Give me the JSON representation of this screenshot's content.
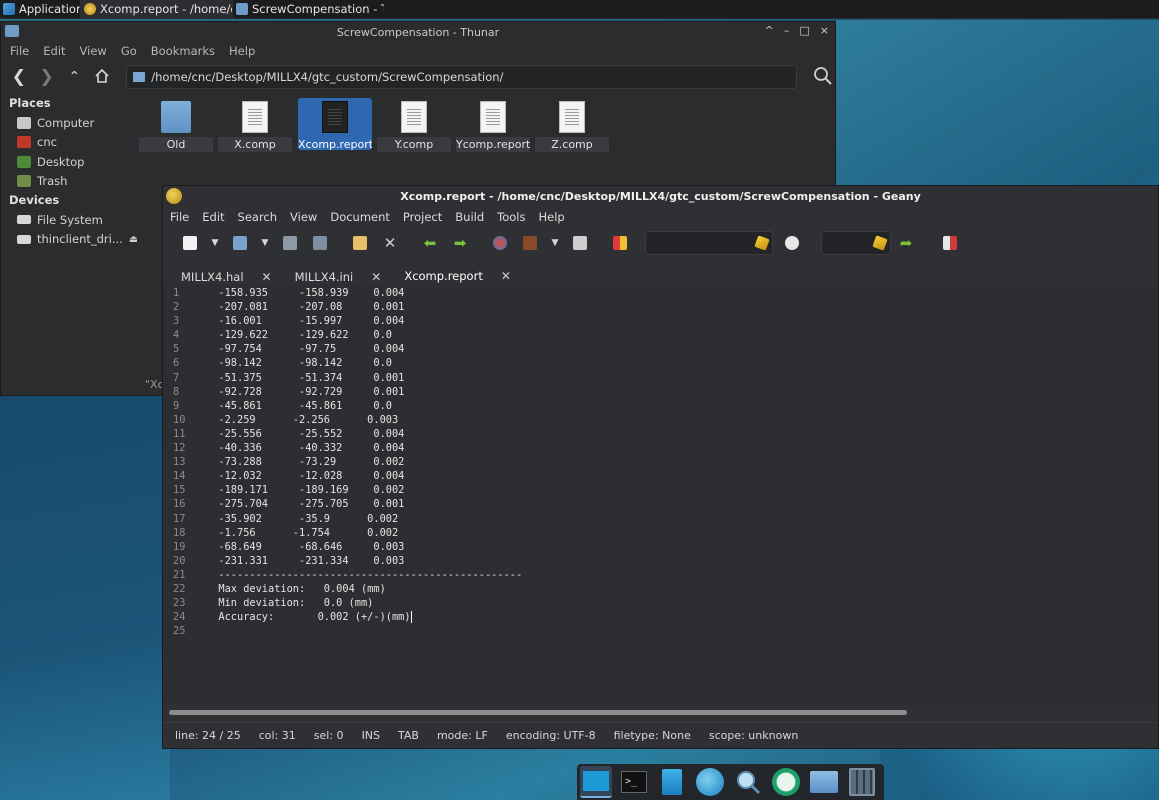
{
  "taskbar": {
    "apps_label": "Applications",
    "tasks": [
      {
        "label": "Xcomp.report - /home/c..."
      },
      {
        "label": "ScrewCompensation - T..."
      }
    ]
  },
  "thunar": {
    "title": "ScrewCompensation - Thunar",
    "controls": {
      "minimize": "^",
      "maximize": "–",
      "restore": "□",
      "close": "×"
    },
    "menu": [
      "File",
      "Edit",
      "View",
      "Go",
      "Bookmarks",
      "Help"
    ],
    "path": "/home/cnc/Desktop/MILLX4/gtc_custom/ScrewCompensation/",
    "places_header": "Places",
    "places": [
      "Computer",
      "cnc",
      "Desktop",
      "Trash"
    ],
    "devices_header": "Devices",
    "devices": [
      "File System",
      "thinclient_dri..."
    ],
    "files": [
      "Old",
      "X.comp",
      "Xcomp.report",
      "Y.comp",
      "Ycomp.report",
      "Z.comp"
    ],
    "selected_file": "Xcomp.report",
    "status_partial": "\"Xc"
  },
  "geany": {
    "title": "Xcomp.report - /home/cnc/Desktop/MILLX4/gtc_custom/ScrewCompensation - Geany",
    "menu": [
      "File",
      "Edit",
      "Search",
      "View",
      "Document",
      "Project",
      "Build",
      "Tools",
      "Help"
    ],
    "tabs": [
      {
        "label": "MILLX4.hal"
      },
      {
        "label": "MILLX4.ini"
      },
      {
        "label": "Xcomp.report"
      }
    ],
    "active_tab": "Xcomp.report",
    "search_placeholder": "",
    "goto_placeholder": "",
    "lines": [
      "-158.935     -158.939    0.004",
      "-207.081     -207.08     0.001",
      "-16.001      -15.997     0.004",
      "-129.622     -129.622    0.0",
      "-97.754      -97.75      0.004",
      "-98.142      -98.142     0.0",
      "-51.375      -51.374     0.001",
      "-92.728      -92.729     0.001",
      "-45.861      -45.861     0.0",
      "-2.259      -2.256      0.003",
      "-25.556      -25.552     0.004",
      "-40.336      -40.332     0.004",
      "-73.288      -73.29      0.002",
      "-12.032      -12.028     0.004",
      "-189.171     -189.169    0.002",
      "-275.704     -275.705    0.001",
      "-35.902      -35.9      0.002",
      "-1.756      -1.754      0.002",
      "-68.649      -68.646     0.003",
      "-231.331     -231.334    0.003",
      "-------------------------------------------------",
      "Max deviation:   0.004 (mm)",
      "Min deviation:   0.0 (mm)",
      "Accuracy:       0.002 (+/-)(mm)",
      ""
    ],
    "status": {
      "line": "line: 24 / 25",
      "col": "col: 31",
      "sel": "sel: 0",
      "ins": "INS",
      "tab": "TAB",
      "mode": "mode: LF",
      "encoding": "encoding: UTF-8",
      "filetype": "filetype: None",
      "scope": "scope: unknown"
    }
  },
  "dock": [
    "show-desktop-icon",
    "terminal-icon",
    "file-manager-icon",
    "web-browser-icon",
    "app-finder-icon",
    "remote-desktop-icon",
    "folder-icon",
    "calculator-icon"
  ],
  "colors": {
    "accent": "#3d83d6",
    "selected_file_bg": "#2f67b0",
    "window_bg": "#2f3033"
  }
}
